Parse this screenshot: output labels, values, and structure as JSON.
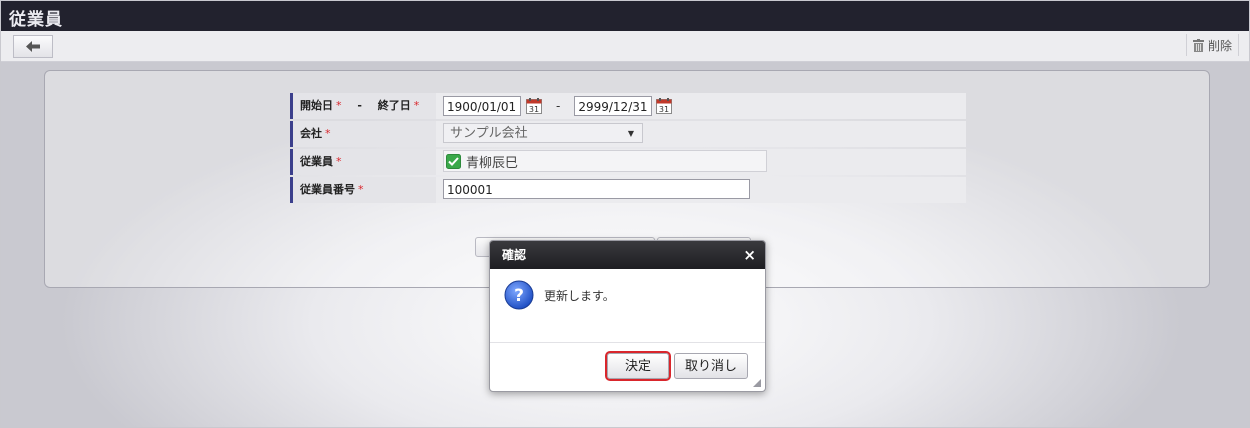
{
  "window": {
    "title": "従業員"
  },
  "toolbar": {
    "back_label": "",
    "delete_label": "削除"
  },
  "form": {
    "rows": [
      {
        "label": "開始日",
        "sep": "-",
        "label2": "終了日",
        "start_date": "1900/01/01",
        "range_sep": "-",
        "end_date": "2999/12/31"
      },
      {
        "label": "会社",
        "value": "サンプル会社"
      },
      {
        "label": "従業員",
        "value": "青柳辰巳",
        "checked": true
      },
      {
        "label": "従業員番号",
        "value": "100001"
      }
    ],
    "required_mark": "*"
  },
  "dialog": {
    "title": "確認",
    "close": "×",
    "message": "更新します。",
    "ok_label": "決定",
    "cancel_label": "取り消し"
  },
  "colors": {
    "titlebar": "#22222e",
    "label_accent": "#3b3f8c",
    "required": "#d9262c",
    "checkbox": "#3aa84a",
    "question_icon": "#2f5fd0"
  },
  "icons": [
    "back-arrow-icon",
    "trash-icon",
    "calendar-icon",
    "checkbox-checked-icon",
    "question-icon",
    "close-icon",
    "resize-grip-icon"
  ]
}
